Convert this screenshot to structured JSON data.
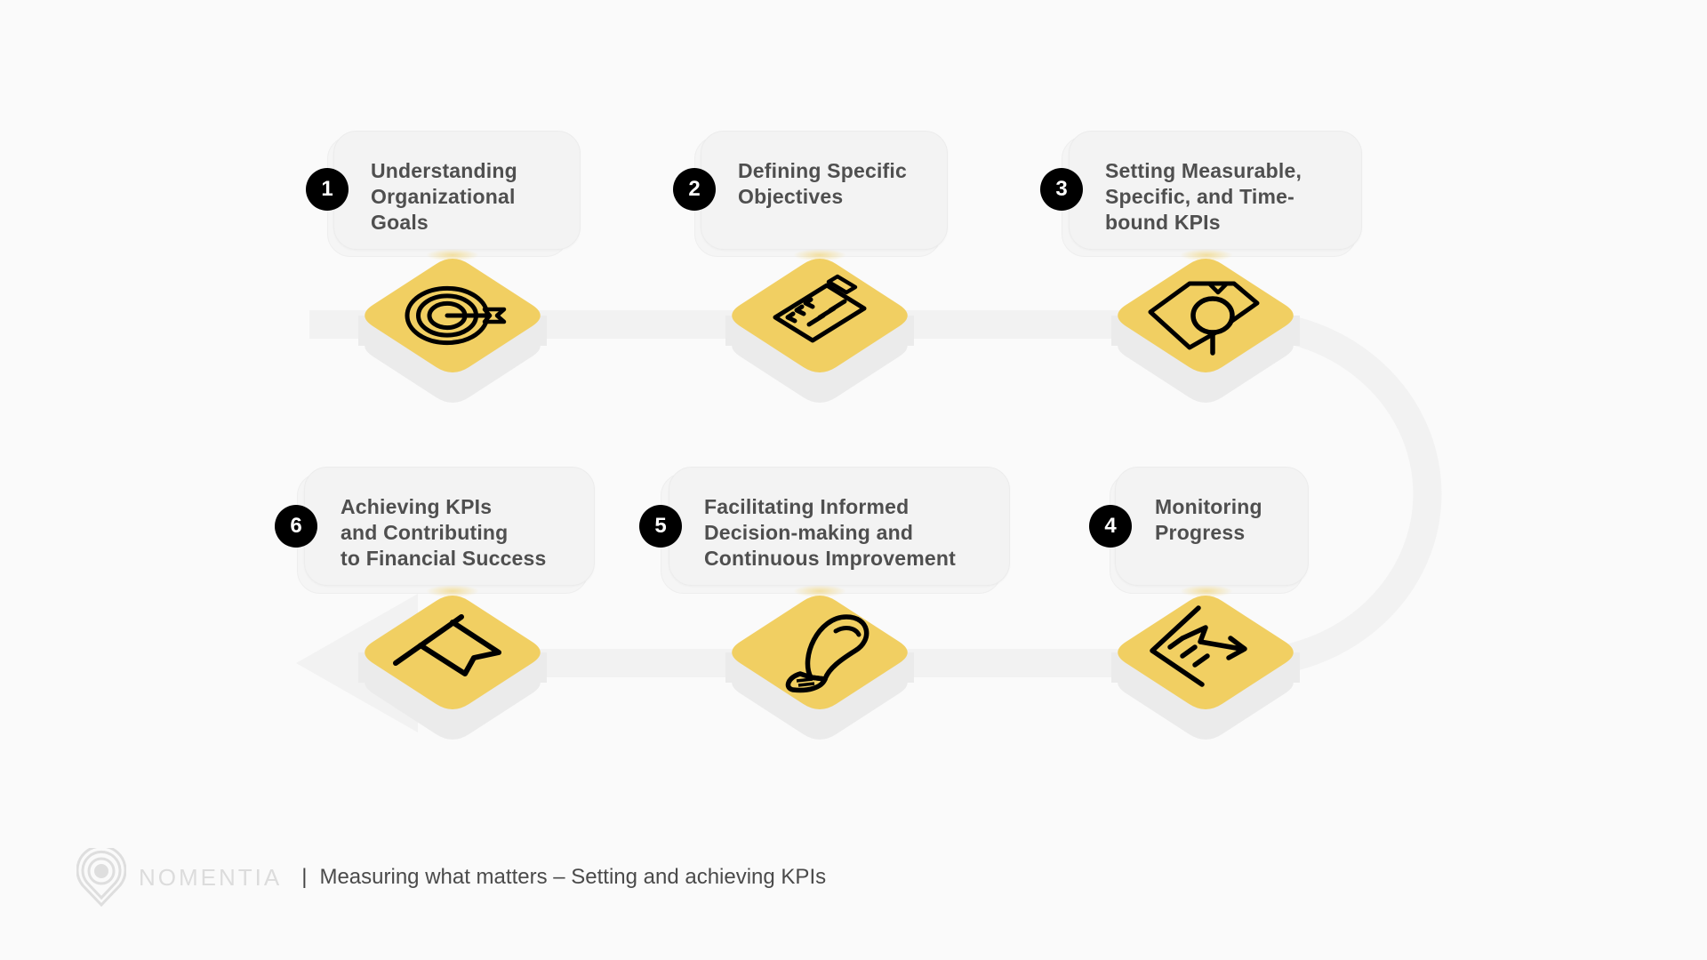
{
  "colors": {
    "background": "#fafafa",
    "track": "#f2f2f2",
    "tile_top": "#f1cf62",
    "tile_side": "#ebebeb",
    "badge": "#000000",
    "text": "#4f4f4f"
  },
  "steps": [
    {
      "number": "1",
      "title": "Understanding\nOrganizational\nGoals",
      "icon": "target-icon"
    },
    {
      "number": "2",
      "title": "Defining Specific\nObjectives",
      "icon": "clipboard-checklist-icon"
    },
    {
      "number": "3",
      "title": "Setting Measurable,\nSpecific, and Time-\nbound KPIs",
      "icon": "document-magnifier-icon"
    },
    {
      "number": "4",
      "title": "Monitoring\nProgress",
      "icon": "chart-trend-arrow-icon"
    },
    {
      "number": "5",
      "title": "Facilitating Informed\nDecision-making and\nContinuous Improvement",
      "icon": "lightbulb-icon"
    },
    {
      "number": "6",
      "title": "Achieving KPIs\nand Contributing\nto Financial Success",
      "icon": "flag-icon"
    }
  ],
  "footer": {
    "brand": "NOMENTIA",
    "separator": "|",
    "subtitle": "Measuring what matters – Setting and achieving KPIs"
  }
}
